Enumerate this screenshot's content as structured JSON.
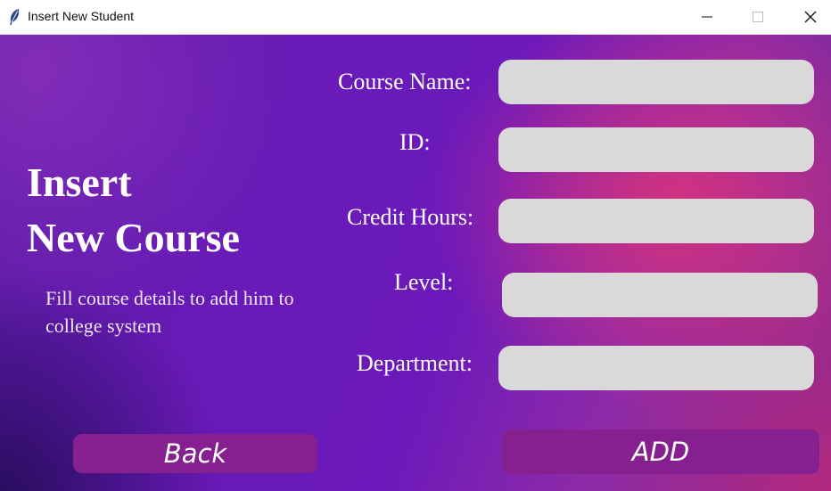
{
  "window": {
    "title": "Insert New Student",
    "title_icon": "feather-icon",
    "controls": [
      "minimize-icon",
      "maximize-icon",
      "close-icon"
    ]
  },
  "panel": {
    "heading_line1": "Insert",
    "heading_line2": "New Course",
    "subtitle": "Fill course details to add him to college system"
  },
  "form": {
    "course_name_label": "Course Name:",
    "course_name_value": "",
    "id_label": "ID:",
    "id_value": "",
    "credit_hours_label": "Credit Hours:",
    "credit_hours_value": "",
    "level_label": "Level:",
    "level_value": "",
    "department_label": "Department:",
    "department_value": ""
  },
  "buttons": {
    "back_label": "Back",
    "add_label": "ADD"
  },
  "colors": {
    "background_purple": "#6a1ab9",
    "background_pink": "#d6327d",
    "field": "#d9d9d9",
    "button": "#861f8f",
    "text": "#ffffff"
  }
}
